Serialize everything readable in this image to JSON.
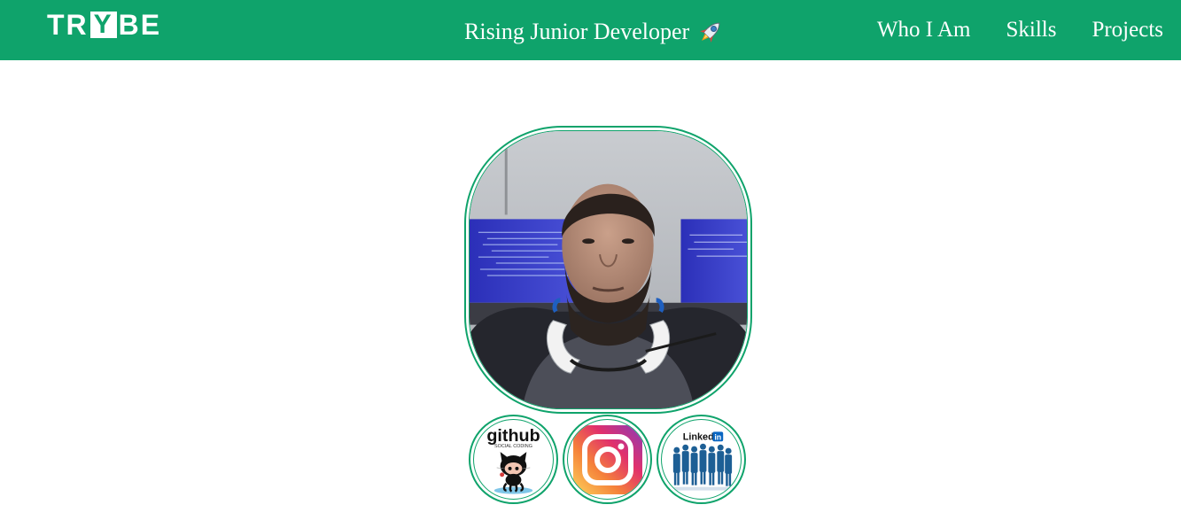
{
  "header": {
    "logo_text": "TRYBE",
    "headline": "Rising Junior Developer",
    "headline_icon": "rocket-icon"
  },
  "nav": {
    "items": [
      {
        "label": "Who I Am"
      },
      {
        "label": "Skills"
      },
      {
        "label": "Projects"
      }
    ]
  },
  "profile": {
    "photo": "profile-photo"
  },
  "social": {
    "github": {
      "icon": "github-icon",
      "logo_text": "github",
      "tagline": "SOCIAL CODING"
    },
    "instagram": {
      "icon": "instagram-icon"
    },
    "linkedin": {
      "icon": "linkedin-icon",
      "logo_text": "Linked",
      "logo_badge": "in"
    }
  },
  "colors": {
    "brand_green": "#0fa36b",
    "background": "#ffffff",
    "text_on_brand": "#ffffff"
  }
}
